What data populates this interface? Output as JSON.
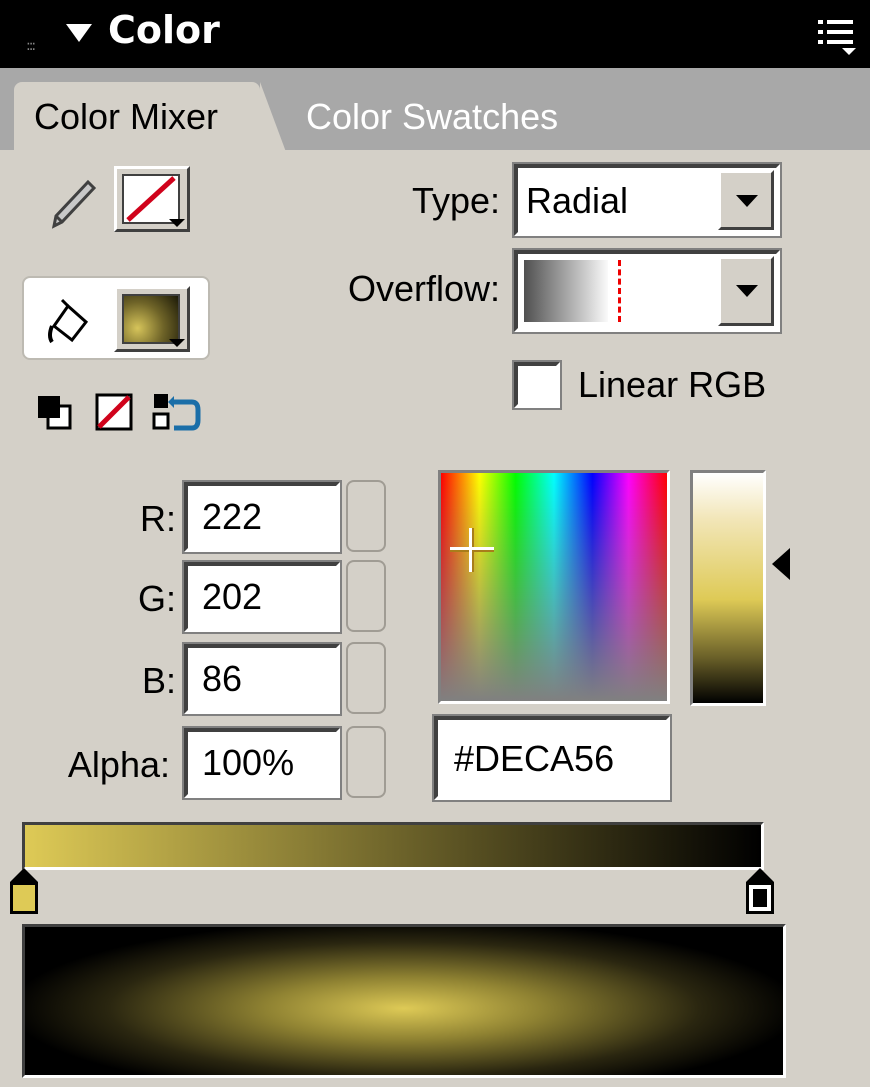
{
  "panel": {
    "title": "Color",
    "tabs": [
      {
        "label": "Color Mixer",
        "active": true
      },
      {
        "label": "Color Swatches",
        "active": false
      }
    ]
  },
  "icons": {
    "pencil": "pencil-icon",
    "stroke_swatch": "no-color",
    "paint_bucket": "paint-bucket-icon",
    "fill_swatch": "gradient",
    "black_white": "black-white-icon",
    "no_color": "no-color-icon",
    "swap_colors": "swap-colors-icon",
    "panel_menu": "panel-menu-icon"
  },
  "fill": {
    "type_label": "Type:",
    "type_value": "Radial",
    "overflow_label": "Overflow:",
    "linear_rgb_label": "Linear RGB",
    "linear_rgb_checked": false
  },
  "rgb": {
    "r_label": "R:",
    "r_value": "222",
    "g_label": "G:",
    "g_value": "202",
    "b_label": "B:",
    "b_value": "86",
    "alpha_label": "Alpha:",
    "alpha_value": "100%"
  },
  "hex_value": "#DECA56",
  "colors": {
    "current": "#deca56",
    "gradient_start": "#deca56",
    "gradient_end": "#000000",
    "stroke_red": "#d0021b"
  }
}
